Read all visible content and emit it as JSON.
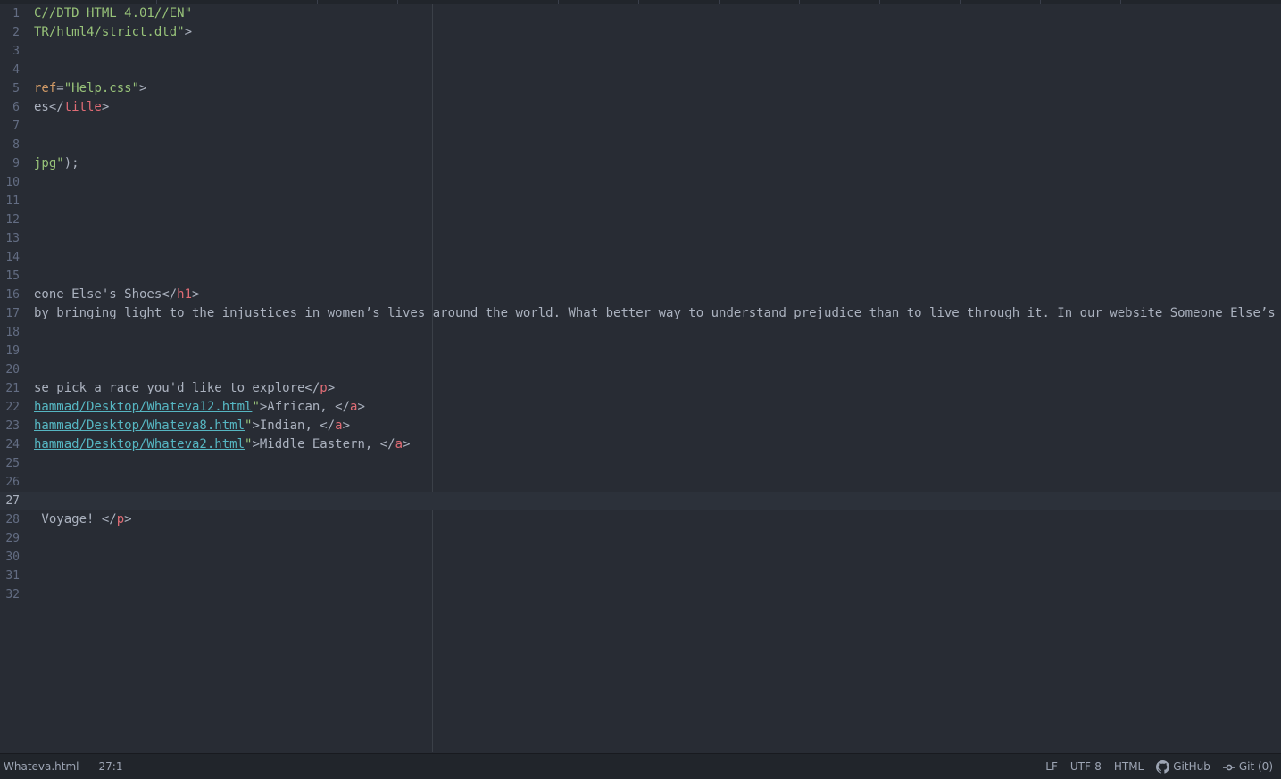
{
  "editor": {
    "lines": [
      {
        "n": "1",
        "parts": [
          {
            "t": "C//DTD HTML 4.01//EN\"",
            "c": "str"
          }
        ]
      },
      {
        "n": "2",
        "parts": [
          {
            "t": "TR/html4/strict.dtd\"",
            "c": "str"
          },
          {
            "t": ">",
            "c": "punct"
          }
        ]
      },
      {
        "n": "3",
        "parts": []
      },
      {
        "n": "4",
        "parts": []
      },
      {
        "n": "5",
        "parts": [
          {
            "t": "ref",
            "c": "attr"
          },
          {
            "t": "=",
            "c": "punct"
          },
          {
            "t": "\"Help.css\"",
            "c": "str"
          },
          {
            "t": ">",
            "c": "punct"
          }
        ]
      },
      {
        "n": "6",
        "parts": [
          {
            "t": "es</",
            "c": "punct"
          },
          {
            "t": "title",
            "c": "tag"
          },
          {
            "t": ">",
            "c": "punct"
          }
        ]
      },
      {
        "n": "7",
        "parts": []
      },
      {
        "n": "8",
        "parts": []
      },
      {
        "n": "9",
        "parts": [
          {
            "t": "jpg\"",
            "c": "str"
          },
          {
            "t": ");",
            "c": "punct"
          }
        ]
      },
      {
        "n": "10",
        "parts": []
      },
      {
        "n": "11",
        "parts": []
      },
      {
        "n": "12",
        "parts": []
      },
      {
        "n": "13",
        "parts": []
      },
      {
        "n": "14",
        "parts": []
      },
      {
        "n": "15",
        "parts": []
      },
      {
        "n": "16",
        "parts": [
          {
            "t": "eone Else's Shoes</",
            "c": "punct"
          },
          {
            "t": "h1",
            "c": "tag"
          },
          {
            "t": ">",
            "c": "punct"
          }
        ]
      },
      {
        "n": "17",
        "parts": [
          {
            "t": "by bringing light to the injustices in women’s lives around the world. What better way to understand prejudice than to live through it. In our website Someone Else’s",
            "c": "punct"
          }
        ]
      },
      {
        "n": "18",
        "parts": []
      },
      {
        "n": "19",
        "parts": []
      },
      {
        "n": "20",
        "parts": []
      },
      {
        "n": "21",
        "parts": [
          {
            "t": "se pick a race you'd like to explore</",
            "c": "punct"
          },
          {
            "t": "p",
            "c": "tag"
          },
          {
            "t": ">",
            "c": "punct"
          }
        ]
      },
      {
        "n": "22",
        "parts": [
          {
            "t": "hammad/Desktop/Whateva12.html",
            "c": "url"
          },
          {
            "t": "\"",
            "c": "str"
          },
          {
            "t": ">African, </",
            "c": "punct"
          },
          {
            "t": "a",
            "c": "tag"
          },
          {
            "t": ">",
            "c": "punct"
          }
        ]
      },
      {
        "n": "23",
        "parts": [
          {
            "t": "hammad/Desktop/Whateva8.html",
            "c": "url"
          },
          {
            "t": "\"",
            "c": "str"
          },
          {
            "t": ">Indian, </",
            "c": "punct"
          },
          {
            "t": "a",
            "c": "tag"
          },
          {
            "t": ">",
            "c": "punct"
          }
        ]
      },
      {
        "n": "24",
        "parts": [
          {
            "t": "hammad/Desktop/Whateva2.html",
            "c": "url"
          },
          {
            "t": "\"",
            "c": "str"
          },
          {
            "t": ">Middle Eastern, </",
            "c": "punct"
          },
          {
            "t": "a",
            "c": "tag"
          },
          {
            "t": ">",
            "c": "punct"
          }
        ]
      },
      {
        "n": "25",
        "parts": []
      },
      {
        "n": "26",
        "parts": []
      },
      {
        "n": "27",
        "parts": [],
        "cursor": true
      },
      {
        "n": "28",
        "parts": [
          {
            "t": " Voyage! </",
            "c": "punct"
          },
          {
            "t": "p",
            "c": "tag"
          },
          {
            "t": ">",
            "c": "punct"
          }
        ]
      },
      {
        "n": "29",
        "parts": []
      },
      {
        "n": "30",
        "parts": []
      },
      {
        "n": "31",
        "parts": []
      },
      {
        "n": "32",
        "parts": []
      }
    ]
  },
  "status": {
    "file_name": "Whateva.html",
    "cursor_position": "27:1",
    "line_ending": "LF",
    "encoding": "UTF-8",
    "grammar": "HTML",
    "github_label": "GitHub",
    "git_label": "Git (0)"
  },
  "icons": {
    "github": "github-icon",
    "git": "git-commit-icon"
  },
  "colors": {
    "background": "#282c34",
    "statusbar": "#21252b",
    "string": "#98c379",
    "attribute": "#d19a66",
    "tag": "#e06c75",
    "link": "#56b6c2",
    "text": "#abb2bf",
    "gutter": "#636d83"
  }
}
